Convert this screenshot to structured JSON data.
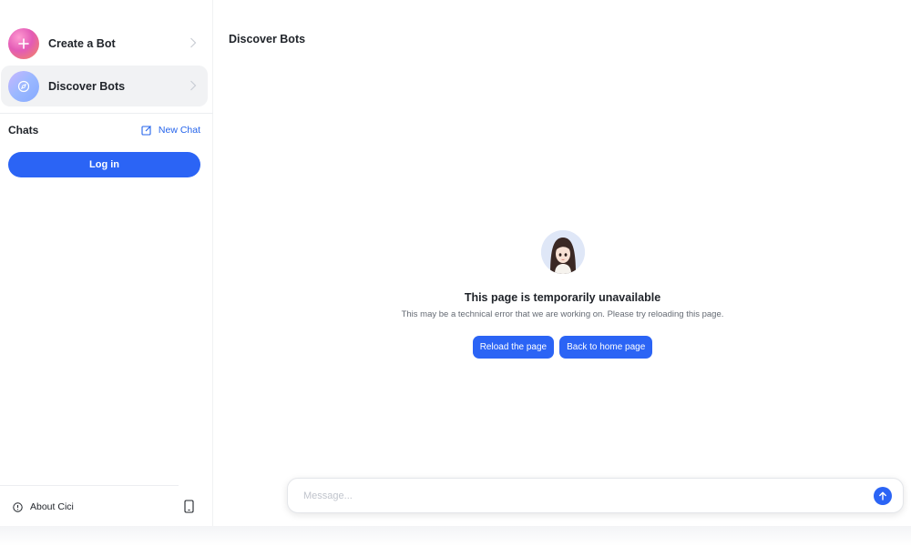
{
  "sidebar": {
    "items": [
      {
        "label": "Create a Bot",
        "icon": "plus-icon"
      },
      {
        "label": "Discover Bots",
        "icon": "compass-icon"
      }
    ],
    "chats_title": "Chats",
    "new_chat_label": "New Chat",
    "login_label": "Log in",
    "about_label": "About Cici"
  },
  "header": {
    "title": "Discover Bots"
  },
  "error": {
    "title": "This page is temporarily unavailable",
    "subtitle": "This may be a technical error that we are working on. Please try reloading this page.",
    "reload_label": "Reload the page",
    "home_label": "Back to home page"
  },
  "composer": {
    "placeholder": "Message..."
  },
  "colors": {
    "accent": "#2b64f5",
    "link": "#2463eb"
  }
}
